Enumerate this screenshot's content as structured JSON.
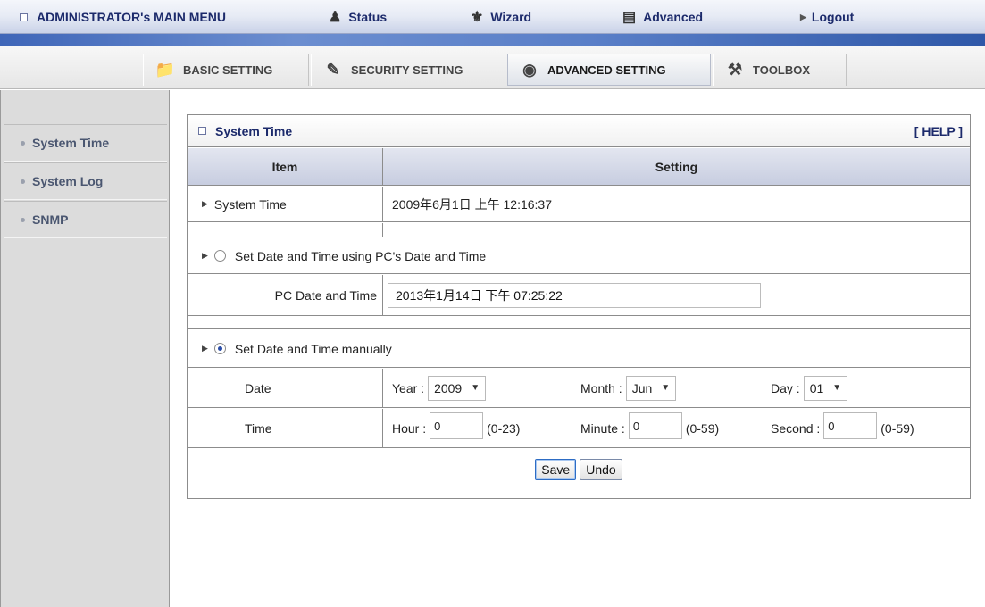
{
  "topbar": {
    "main_menu": "ADMINISTRATOR's MAIN MENU",
    "status": "Status",
    "wizard": "Wizard",
    "advanced": "Advanced",
    "logout": "Logout"
  },
  "tabs": [
    {
      "label": "BASIC SETTING",
      "icon": "folder-icon"
    },
    {
      "label": "SECURITY SETTING",
      "icon": "pen-icon"
    },
    {
      "label": "ADVANCED SETTING",
      "icon": "disc-icon"
    },
    {
      "label": "TOOLBOX",
      "icon": "toolbox-icon"
    }
  ],
  "sidebar": {
    "items": [
      {
        "label": "System Time"
      },
      {
        "label": "System Log"
      },
      {
        "label": "SNMP"
      }
    ]
  },
  "panel": {
    "title": "System Time",
    "help": "[ HELP ]",
    "col_item": "Item",
    "col_setting": "Setting",
    "system_time_label": "System Time",
    "system_time_value": "2009年6月1日 上午 12:16:37",
    "pc_option_label": "Set Date and Time using PC's Date and Time",
    "pc_datetime_label": "PC Date and Time",
    "pc_datetime_value": "2013年1月14日 下午 07:25:22",
    "manual_option_label": "Set Date and Time manually",
    "date_label": "Date",
    "time_label": "Time",
    "year_label": "Year :",
    "year_value": "2009",
    "month_label": "Month :",
    "month_value": "Jun",
    "day_label": "Day :",
    "day_value": "01",
    "hour_label": "Hour :",
    "hour_value": "0",
    "hour_range": "(0-23)",
    "minute_label": "Minute :",
    "minute_value": "0",
    "minute_range": "(0-59)",
    "second_label": "Second :",
    "second_value": "0",
    "second_range": "(0-59)",
    "save": "Save",
    "undo": "Undo"
  }
}
